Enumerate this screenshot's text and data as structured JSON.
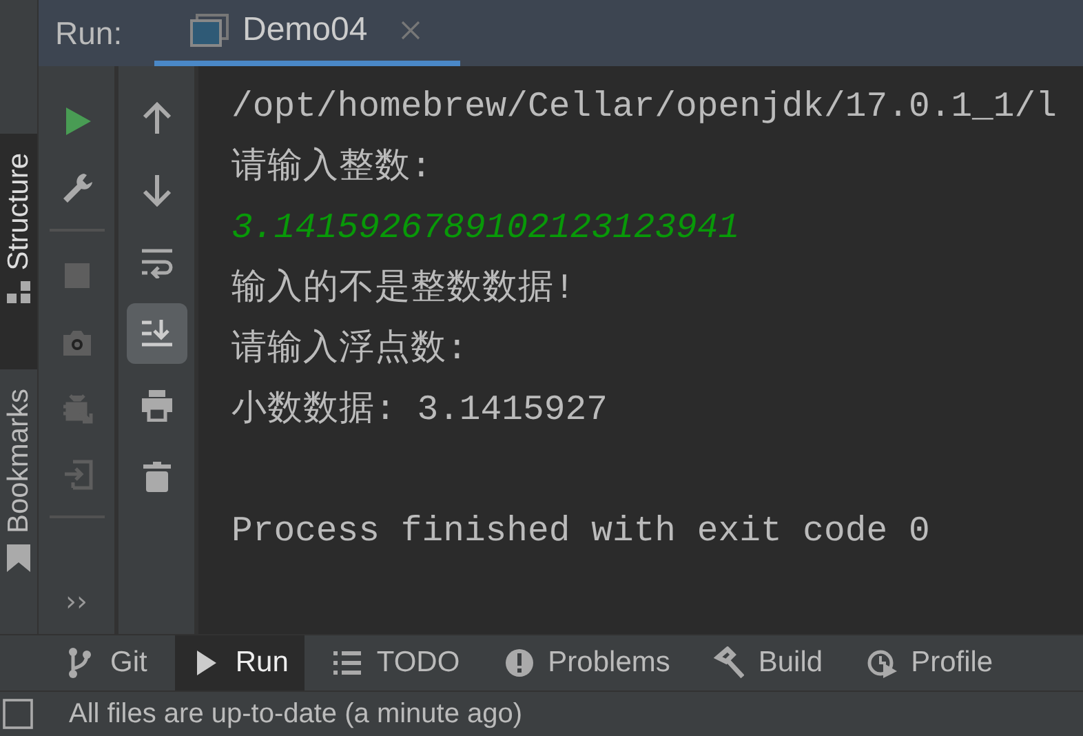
{
  "side_tabs": [
    {
      "label": "Structure",
      "selected": true
    },
    {
      "label": "Bookmarks",
      "selected": false
    }
  ],
  "run_header": {
    "label": "Run:",
    "tabs": [
      {
        "label": "Demo04",
        "selected": true
      }
    ]
  },
  "toolbar_left": [
    {
      "disabled": false
    },
    {
      "disabled": false
    },
    {
      "kind": "separator"
    },
    {
      "disabled": true
    },
    {
      "disabled": true
    },
    {
      "disabled": true
    },
    {
      "disabled": true
    },
    {
      "kind": "separator"
    },
    {
      "kind": "more",
      "label": "››"
    }
  ],
  "toolbar_right": [
    {
      "selected": false
    },
    {
      "selected": false
    },
    {
      "selected": false
    },
    {
      "selected": true
    },
    {
      "selected": false
    },
    {
      "selected": false
    }
  ],
  "console": [
    {
      "kind": "output",
      "text": "/opt/homebrew/Cellar/openjdk/17.0.1_1/l"
    },
    {
      "kind": "output",
      "text": "请输入整数:"
    },
    {
      "kind": "input",
      "text": "3.1415926789102123123941"
    },
    {
      "kind": "output",
      "text": "输入的不是整数数据!"
    },
    {
      "kind": "output",
      "text": "请输入浮点数:"
    },
    {
      "kind": "output",
      "text": "小数数据: 3.1415927"
    },
    {
      "kind": "blank"
    },
    {
      "kind": "output",
      "text": "Process finished with exit code 0"
    }
  ],
  "bottom_tabs": [
    {
      "label": "Git",
      "selected": false
    },
    {
      "label": "Run",
      "selected": true
    },
    {
      "label": "TODO",
      "selected": false
    },
    {
      "label": "Problems",
      "selected": false
    },
    {
      "label": "Build",
      "selected": false
    },
    {
      "label": "Profile",
      "selected": false
    }
  ],
  "status_bar": {
    "text": "All files are up-to-date (a minute ago)"
  }
}
